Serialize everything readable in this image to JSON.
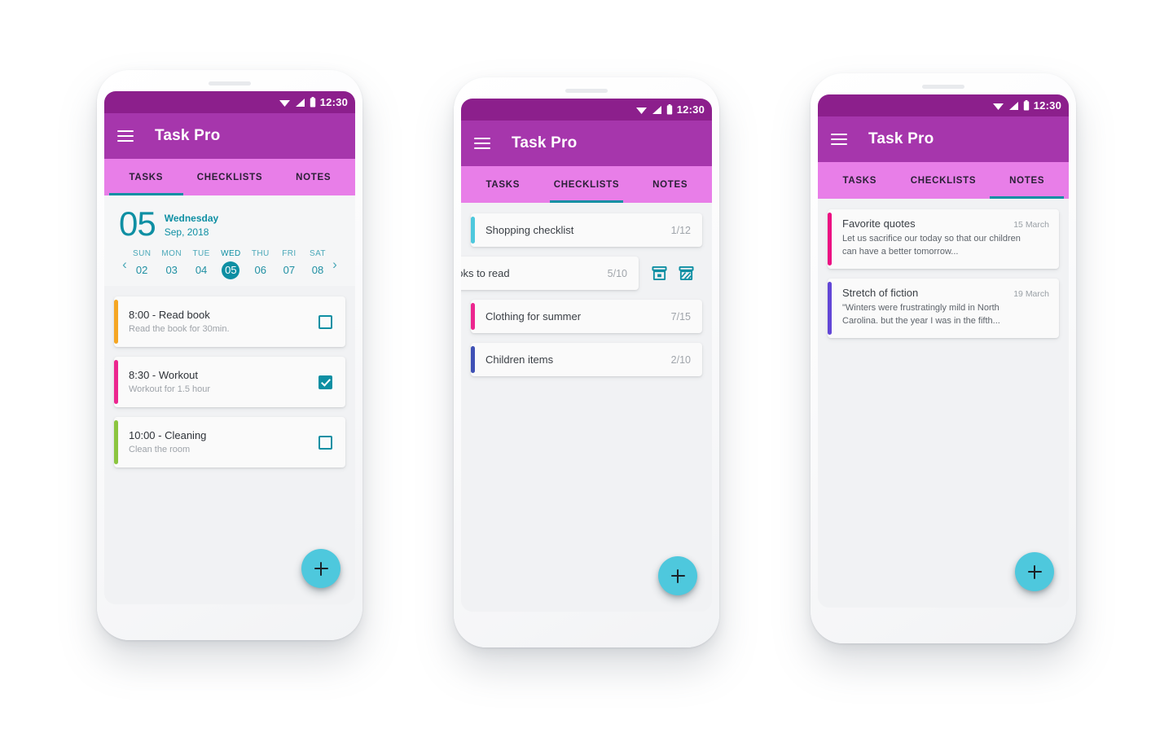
{
  "app": {
    "title": "Task Pro",
    "menu_icon": "hamburger-menu-icon",
    "accent_purple": "#a636ac",
    "accent_statusbar": "#8c1f8c",
    "accent_tabs": "#e87ee8",
    "accent_teal": "#0e8fa3",
    "accent_fab": "#4ec8dd"
  },
  "status_bar": {
    "time": "12:30",
    "icons": [
      "wifi-icon",
      "signal-icon",
      "battery-icon"
    ]
  },
  "tabs": [
    {
      "label": "TASKS"
    },
    {
      "label": "CHECKLISTS"
    },
    {
      "label": "NOTES"
    }
  ],
  "fab": {
    "label": "+",
    "name": "add-button"
  },
  "screen_tasks": {
    "active_tab": "TASKS",
    "date": {
      "day": "05",
      "weekday": "Wednesday",
      "month_year": "Sep, 2018"
    },
    "week": {
      "prev_label": "‹",
      "next_label": "›",
      "days": [
        {
          "name": "SUN",
          "num": "02",
          "selected": false
        },
        {
          "name": "MON",
          "num": "03",
          "selected": false
        },
        {
          "name": "TUE",
          "num": "04",
          "selected": false
        },
        {
          "name": "WED",
          "num": "05",
          "selected": true
        },
        {
          "name": "THU",
          "num": "06",
          "selected": false
        },
        {
          "name": "FRI",
          "num": "07",
          "selected": false
        },
        {
          "name": "SAT",
          "num": "08",
          "selected": false
        }
      ]
    },
    "tasks": [
      {
        "title": "8:00 - Read book",
        "subtitle": "Read the book for 30min.",
        "checked": false,
        "accent": "#f5a623"
      },
      {
        "title": "8:30 - Workout",
        "subtitle": "Workout for 1.5 hour",
        "checked": true,
        "accent": "#ec268f"
      },
      {
        "title": "10:00 - Cleaning",
        "subtitle": "Clean the room",
        "checked": false,
        "accent": "#8bc53f"
      }
    ]
  },
  "screen_checklists": {
    "active_tab": "CHECKLISTS",
    "checklists": [
      {
        "title": "Shopping checklist",
        "count": "1/12",
        "accent": "#4ec8dd",
        "swiped": false
      },
      {
        "title": "ooks to read",
        "count": "5/10",
        "accent": "#4ec8dd",
        "swiped": true
      },
      {
        "title": "Clothing for summer",
        "count": "7/15",
        "accent": "#ec268f",
        "swiped": false
      },
      {
        "title": "Children items",
        "count": "2/10",
        "accent": "#3f51b5",
        "swiped": false
      }
    ],
    "swipe_actions": [
      {
        "name": "archive-icon"
      },
      {
        "name": "delete-icon"
      }
    ]
  },
  "screen_notes": {
    "active_tab": "NOTES",
    "notes": [
      {
        "title": "Favorite quotes",
        "date": "15 March",
        "body": "Let us sacrifice our today so that our children can have a better tomorrow...",
        "accent": "#ec0f82"
      },
      {
        "title": "Stretch of fiction",
        "date": "19 March",
        "body": "\"Winters were frustratingly mild in North Carolina. but the year I was in the fifth...",
        "accent": "#6246d6"
      }
    ]
  }
}
